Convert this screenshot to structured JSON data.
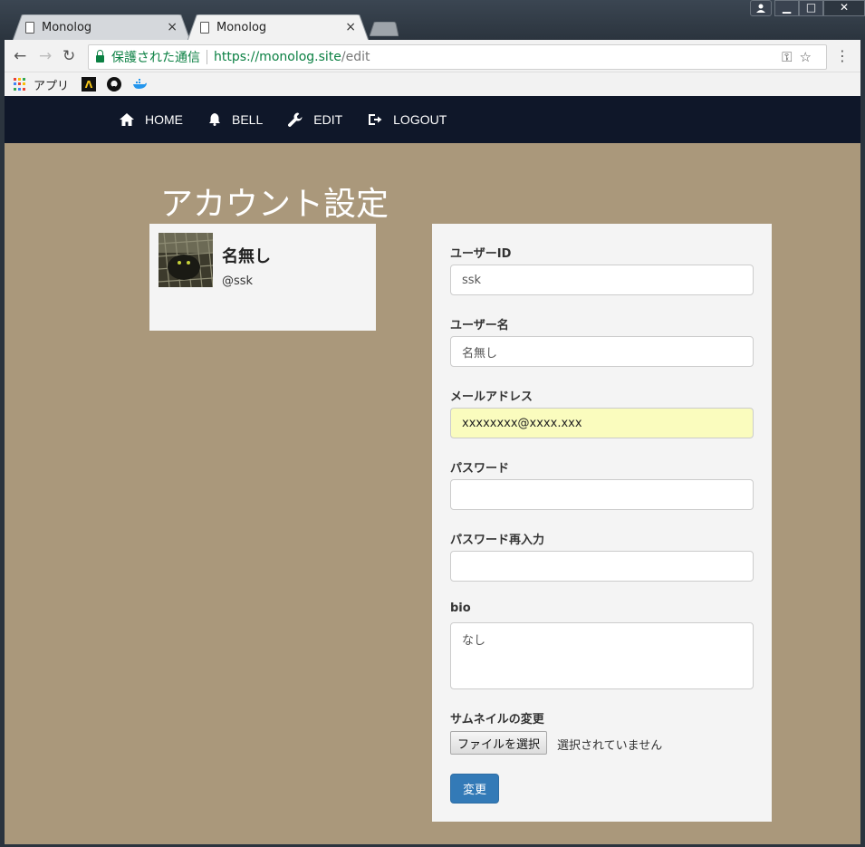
{
  "browser": {
    "tabs": [
      {
        "title": "Monolog"
      },
      {
        "title": "Monolog"
      }
    ],
    "tab_close_glyph": "×",
    "window_buttons": {
      "minimize": "▁",
      "maximize": "□",
      "close": "✕"
    },
    "address": {
      "secure_label": "保護された通信",
      "url_scheme_host": "https://monolog.site",
      "url_path": "/edit"
    },
    "bookmarks": {
      "apps_label": "アプリ"
    }
  },
  "navbar": {
    "items": [
      {
        "label": "HOME",
        "icon": "home-icon"
      },
      {
        "label": "BELL",
        "icon": "bell-icon"
      },
      {
        "label": "EDIT",
        "icon": "wrench-icon"
      },
      {
        "label": "LOGOUT",
        "icon": "logout-icon"
      }
    ]
  },
  "page": {
    "title": "アカウント設定"
  },
  "profile": {
    "name": "名無し",
    "handle": "@ssk"
  },
  "form": {
    "user_id_label": "ユーザーID",
    "user_id_value": "ssk",
    "user_name_label": "ユーザー名",
    "user_name_value": "名無し",
    "email_label": "メールアドレス",
    "email_value": "xxxxxxxx@xxxx.xxx",
    "password_label": "パスワード",
    "password_value": "",
    "password_confirm_label": "パスワード再入力",
    "password_confirm_value": "",
    "bio_label": "bio",
    "bio_value": "なし",
    "thumbnail_label": "サムネイルの変更",
    "file_button_label": "ファイルを選択",
    "file_status": "選択されていません",
    "submit_label": "変更"
  },
  "colors": {
    "navbar_bg": "#0f1729",
    "page_bg": "#aa987b",
    "panel_bg": "#f4f4f4",
    "primary_button": "#337ab7",
    "autofill_bg": "#fafcbe",
    "secure_green": "#0b8043"
  }
}
